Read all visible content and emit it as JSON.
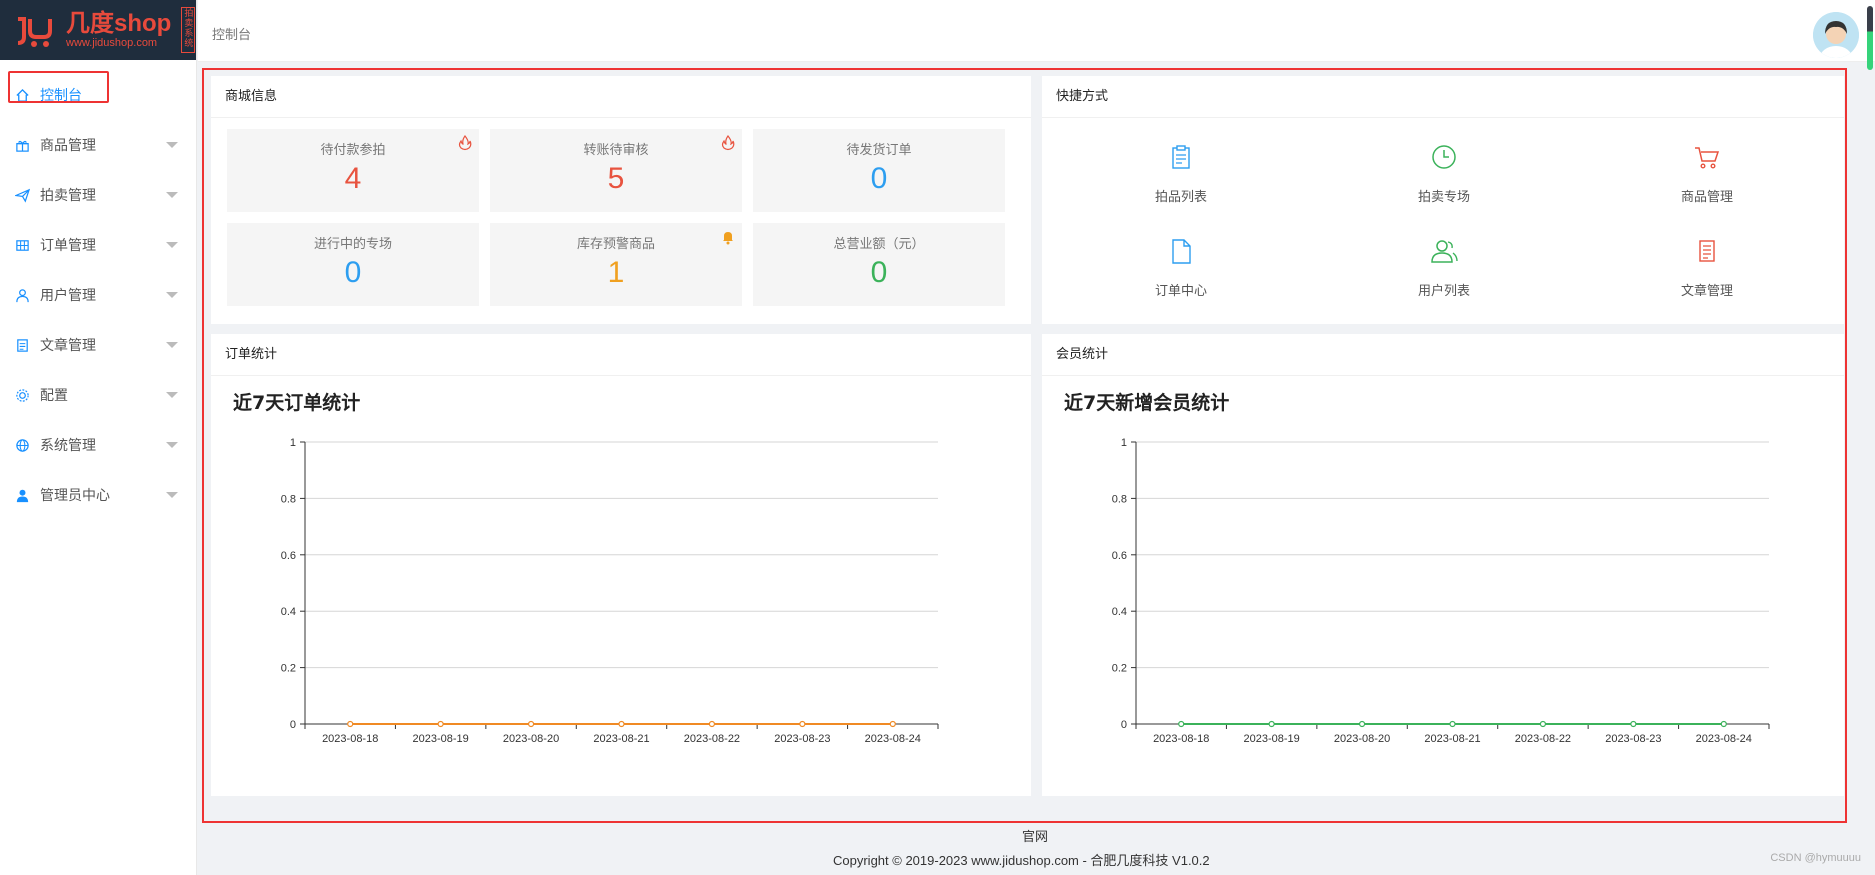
{
  "logo": {
    "brand": "几度shop",
    "site": "www.jidushop.com",
    "badge": "拍卖系统"
  },
  "sidebar": {
    "items": [
      {
        "label": "控制台",
        "icon": "home-icon",
        "active": true
      },
      {
        "label": "商品管理",
        "icon": "gift-icon"
      },
      {
        "label": "拍卖管理",
        "icon": "send-icon"
      },
      {
        "label": "订单管理",
        "icon": "grid-icon"
      },
      {
        "label": "用户管理",
        "icon": "user-icon"
      },
      {
        "label": "文章管理",
        "icon": "document-icon"
      },
      {
        "label": "配置",
        "icon": "gear-icon"
      },
      {
        "label": "系统管理",
        "icon": "globe-icon"
      },
      {
        "label": "管理员中心",
        "icon": "admin-icon"
      }
    ]
  },
  "header": {
    "breadcrumb": "控制台"
  },
  "shop_info": {
    "title": "商城信息",
    "stats": [
      {
        "label": "待付款参拍",
        "value": "4",
        "color": "#e8533f",
        "corner": "fire-icon"
      },
      {
        "label": "转账待审核",
        "value": "5",
        "color": "#e8533f",
        "corner": "fire-icon"
      },
      {
        "label": "待发货订单",
        "value": "0",
        "color": "#2d9ef0"
      },
      {
        "label": "进行中的专场",
        "value": "0",
        "color": "#2d9ef0"
      },
      {
        "label": "库存预警商品",
        "value": "1",
        "color": "#f0a020",
        "corner": "bell-icon"
      },
      {
        "label": "总营业额（元）",
        "value": "0",
        "color": "#3bb25a"
      }
    ]
  },
  "shortcuts": {
    "title": "快捷方式",
    "items": [
      {
        "label": "拍品列表",
        "icon": "clipboard-icon",
        "color": "#2d9ef0"
      },
      {
        "label": "拍卖专场",
        "icon": "clock-icon",
        "color": "#3bb25a"
      },
      {
        "label": "商品管理",
        "icon": "cart-icon",
        "color": "#e8533f"
      },
      {
        "label": "订单中心",
        "icon": "file-icon",
        "color": "#2d9ef0"
      },
      {
        "label": "用户列表",
        "icon": "users-icon",
        "color": "#3bb25a"
      },
      {
        "label": "文章管理",
        "icon": "article-icon",
        "color": "#e8533f"
      }
    ]
  },
  "order_stats": {
    "panel_title": "订单统计",
    "chart_title": "近7天订单统计"
  },
  "member_stats": {
    "panel_title": "会员统计",
    "chart_title": "近7天新增会员统计"
  },
  "chart_data": [
    {
      "type": "line",
      "title": "近7天订单统计",
      "categories": [
        "2023-08-18",
        "2023-08-19",
        "2023-08-20",
        "2023-08-21",
        "2023-08-22",
        "2023-08-23",
        "2023-08-24"
      ],
      "series": [
        {
          "values": [
            0,
            0,
            0,
            0,
            0,
            0,
            0
          ],
          "color": "#f08a24"
        }
      ],
      "yticks": [
        "0",
        "0.2",
        "0.4",
        "0.6",
        "0.8",
        "1"
      ],
      "ylim": [
        0,
        1
      ],
      "grid": true
    },
    {
      "type": "line",
      "title": "近7天新增会员统计",
      "categories": [
        "2023-08-18",
        "2023-08-19",
        "2023-08-20",
        "2023-08-21",
        "2023-08-22",
        "2023-08-23",
        "2023-08-24"
      ],
      "series": [
        {
          "values": [
            0,
            0,
            0,
            0,
            0,
            0,
            0
          ],
          "color": "#3bb25a"
        }
      ],
      "yticks": [
        "0",
        "0.2",
        "0.4",
        "0.6",
        "0.8",
        "1"
      ],
      "ylim": [
        0,
        1
      ],
      "grid": true
    }
  ],
  "footer": {
    "link": "官网",
    "copyright": "Copyright © 2019-2023 www.jidushop.com - 合肥几度科技 V1.0.2",
    "watermark": "CSDN @hymuuuu"
  }
}
